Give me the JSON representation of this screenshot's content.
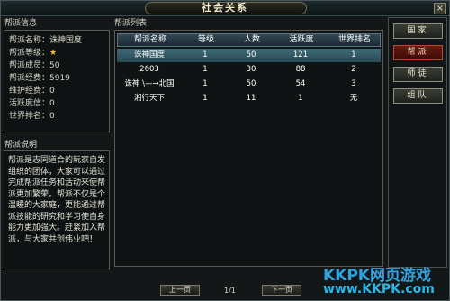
{
  "window": {
    "title": "社会关系",
    "close": "×"
  },
  "guild_info": {
    "section_label": "帮派信息",
    "name_label": "帮派名称：",
    "name_value": "诛神国度",
    "level_label": "帮派等级：",
    "members_line": "帮派成员：50",
    "funds_line": "帮派经费：5919",
    "maintenance_line": "维护经费：0",
    "activity_line": "活跃度信：0",
    "rank_line": "世界排名：0"
  },
  "guild_desc": {
    "section_label": "帮派说明",
    "lines": [
      "帮派是志同道合的玩家自发",
      "组织的团体，大家可以通过",
      "完成帮派任务和活动来使帮",
      "派更加繁荣。帮派不仅是个",
      "温暖的大家庭，更能通过帮",
      "派技能的研究和学习使自身",
      "能力更加强大。赶紧加入帮",
      "派，与大家共创伟业吧！"
    ]
  },
  "guild_list": {
    "section_label": "帮派列表",
    "columns": [
      "帮派名称",
      "等级",
      "人数",
      "活跃度",
      "世界排名"
    ],
    "rows": [
      [
        "诛神国度",
        "1",
        "50",
        "121",
        "1"
      ],
      [
        "2603",
        "1",
        "30",
        "88",
        "2"
      ],
      [
        "诛神 \\—→北国",
        "1",
        "50",
        "54",
        "3"
      ],
      [
        "湘行天下",
        "1",
        "11",
        "1",
        "无"
      ]
    ]
  },
  "sidebar": {
    "buttons": [
      "国家",
      "帮派",
      "师徒",
      "组队"
    ],
    "active": "帮派"
  },
  "pager": {
    "prev": "上一页",
    "page": "1/1",
    "next": "下一页"
  },
  "watermark": {
    "top": "KKPK网页游戏",
    "bottom": "www.KKPK.com"
  },
  "colors": {
    "selected_row": "#3e6b78",
    "active_tab": "#6b1b10",
    "watermark": "#2fa2e0"
  }
}
